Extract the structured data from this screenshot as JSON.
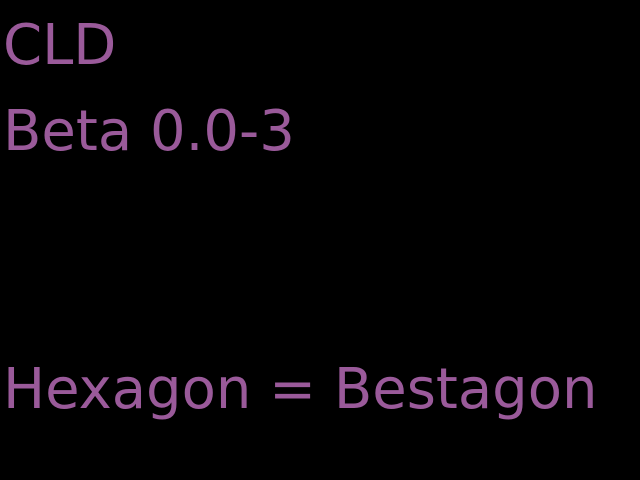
{
  "screen": {
    "lines": [
      "CLD",
      "Beta 0.0-3",
      "Hexagon = Bestagon"
    ]
  },
  "colors": {
    "background": "#000000",
    "text": "#9a5a9a"
  }
}
